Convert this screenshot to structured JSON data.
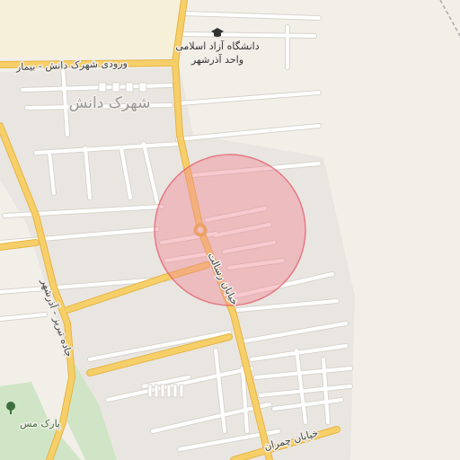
{
  "map": {
    "colors": {
      "background": "#f2efe9",
      "urban_area": "#e9e6e1",
      "yellow_zone": "#f7f0d8",
      "major_road": "#f7cf69",
      "major_road_casing": "#e5b544",
      "minor_road": "#ffffff",
      "minor_road_casing": "#d8d4cc",
      "park": "#cfe5c6",
      "highlight_fill": "#f08a94",
      "highlight_stroke": "#e35566"
    },
    "labels": {
      "university_line1": "دانشگاه آزاد اسلامی",
      "university_line2": "واحد آذرشهر",
      "entrance_road": "ورودی شهرک دانش - بیمار",
      "district": "شهرک دانش",
      "street_resalat": "خیابان رسالت",
      "highway": "جاده تبریز - آذرشهر",
      "park": "پارک مس",
      "street_chamran": "خیابان چمران"
    },
    "icons": {
      "university": "graduation-cap-icon",
      "park": "tree-icon",
      "roundabout": "roundabout-icon"
    }
  }
}
